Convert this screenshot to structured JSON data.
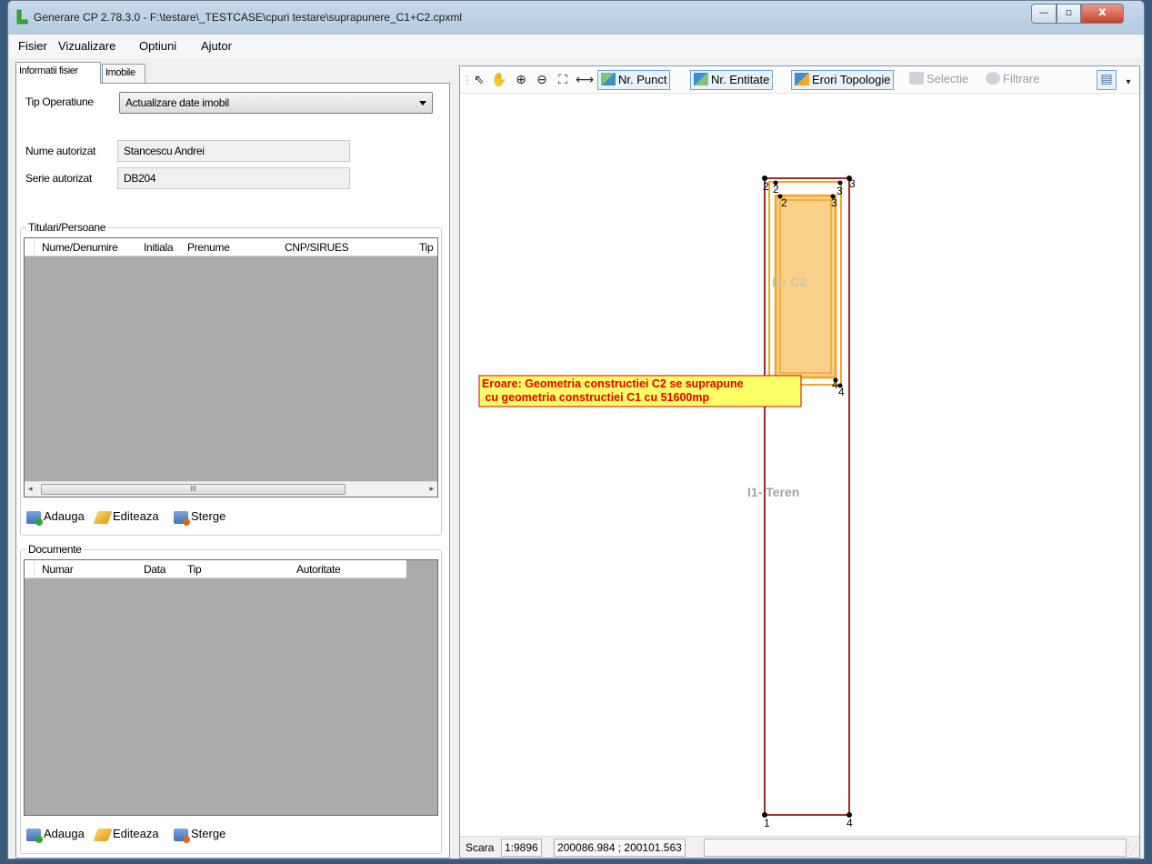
{
  "window": {
    "title": "Generare CP 2.78.3.0 - F:\\testare\\_TESTCASE\\cpuri testare\\suprapunere_C1+C2.cpxml",
    "min_glyph": "—",
    "max_glyph": "▫",
    "close_glyph": "x"
  },
  "menu": [
    "Fisier",
    "Vizualizare",
    "Optiuni",
    "Ajutor"
  ],
  "left_tabs": [
    "Informatii fisier",
    "Imobile"
  ],
  "info": {
    "tip_operatiune_label": "Tip Operatiune",
    "tip_operatiune_value": "Actualizare date imobil",
    "nume_autorizat_label": "Nume autorizat",
    "nume_autorizat_value": "Stancescu Andrei",
    "serie_autorizat_label": "Serie autorizat",
    "serie_autorizat_value": "DB204"
  },
  "titulari": {
    "title": "Titulari/Persoane",
    "columns": [
      "Nume/Denumire",
      "Initiala",
      "Prenume",
      "CNP/SIRUES",
      "Tip"
    ],
    "scroll_thumb_glyph": "III",
    "scroll_left": "◂",
    "scroll_right": "▸",
    "actions": [
      "Adauga",
      "Editeaza",
      "Sterge"
    ]
  },
  "documente": {
    "title": "Documente",
    "columns": [
      "Numar",
      "Data",
      "Tip",
      "Autoritate"
    ],
    "actions": [
      "Adauga",
      "Editeaza",
      "Sterge"
    ]
  },
  "toolbar": {
    "icons": [
      "select-arrow-icon",
      "pan-hand-icon",
      "zoom-in-icon",
      "zoom-out-icon",
      "zoom-extent-icon",
      "measure-icon"
    ],
    "icon_glyphs": [
      "⇖",
      "✋",
      "⊕",
      "⊖",
      "⛶",
      "⟷"
    ],
    "toggles": [
      "Nr. Punct",
      "Nr. Entitate",
      "Erori Topologie"
    ],
    "disabled": [
      "Selectie",
      "Filtrare"
    ],
    "layout_glyph": "▤",
    "overflow_glyph": "▾"
  },
  "map": {
    "teren_label": "I1- Teren",
    "constructie_label": "I1- C2",
    "error_line1": "Eroare: Geometria constructiei C2 se suprapune",
    "error_line2": " cu geometria constructiei C1 cu 51600mp",
    "point_labels": [
      "1",
      "2",
      "2",
      "2",
      "3",
      "3",
      "3",
      "4",
      "4",
      "4"
    ],
    "colors": {
      "parcel": "#9b2d2d",
      "building_outline": "#f2a623",
      "building_fill": "#f9cf8a",
      "error_bg": "#ffff66",
      "error_text": "#e00000"
    }
  },
  "status": {
    "scara_label": "Scara",
    "scara_value": "1:9896",
    "coords": "200086.984 ; 200101.563"
  }
}
